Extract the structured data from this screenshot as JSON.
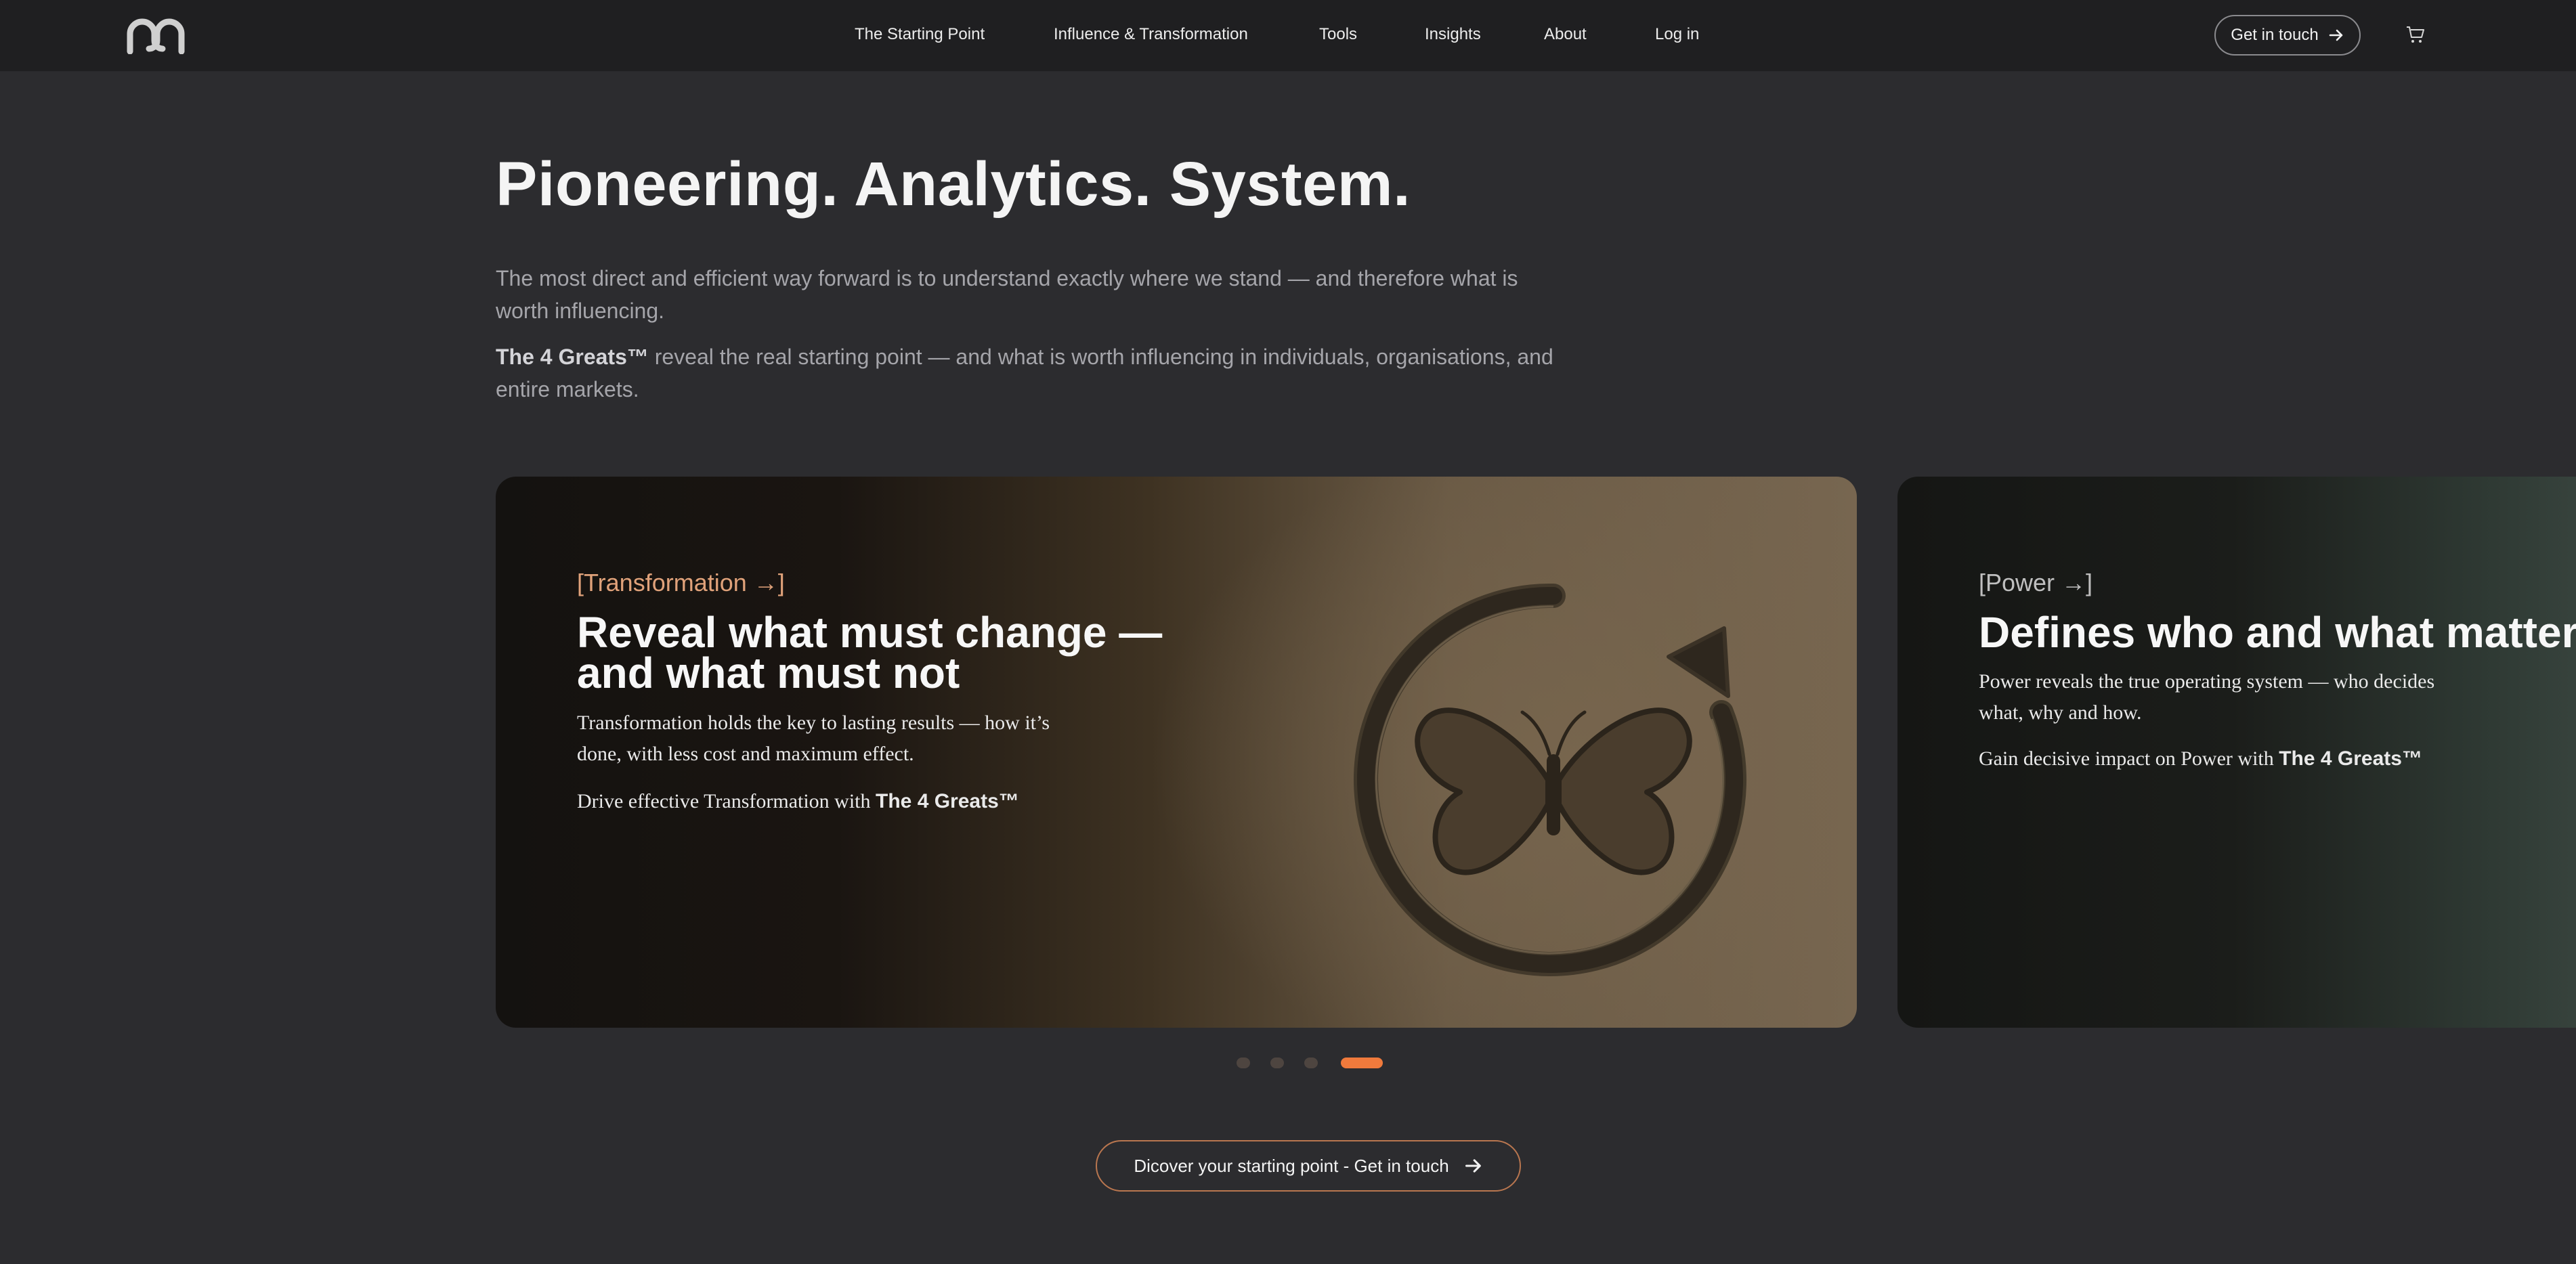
{
  "nav": {
    "links": [
      "The Starting Point",
      "Influence & Transformation",
      "Tools",
      "Insights",
      "About",
      "Log in"
    ],
    "cta_label": "Get in touch"
  },
  "hero": {
    "title": "Pioneering. Analytics. System.",
    "para1": "The most direct and efficient way forward is to understand exactly where we stand — and therefore what is worth influencing.",
    "para2_brand": "The 4 Greats™",
    "para2_rest": " reveal the real starting point — and what is worth influencing in individuals, organisations, and entire markets."
  },
  "cards": [
    {
      "tag": "[Transformation →]",
      "title": "Reveal what must change — and what must not",
      "body": "Transformation holds the key to lasting results — how it’s done, with less cost and maximum effect.",
      "cta_prefix": "Drive effective Transformation with ",
      "cta_brand": "The 4 Greats™"
    },
    {
      "tag": "[Power →]",
      "title": "Defines who and what matters",
      "body": "Power reveals the true operating system — who decides what, why and how.",
      "cta_prefix": "Gain decisive impact on Power with ",
      "cta_brand": "The 4 Greats™"
    }
  ],
  "carousel": {
    "slide_count": 4,
    "active_slide": 4
  },
  "cta": {
    "label": "Dicover your starting point - Get in touch"
  },
  "colors": {
    "accent": "#f07a3c",
    "tag_accent": "#e0a27a",
    "background": "#2c2c2f",
    "nav_background": "#1f1f21"
  },
  "icons": {
    "logo": "brand-logo",
    "cart": "cart-icon",
    "arrow": "arrow-right-icon",
    "emblem": "butterfly-cycle-emblem"
  }
}
